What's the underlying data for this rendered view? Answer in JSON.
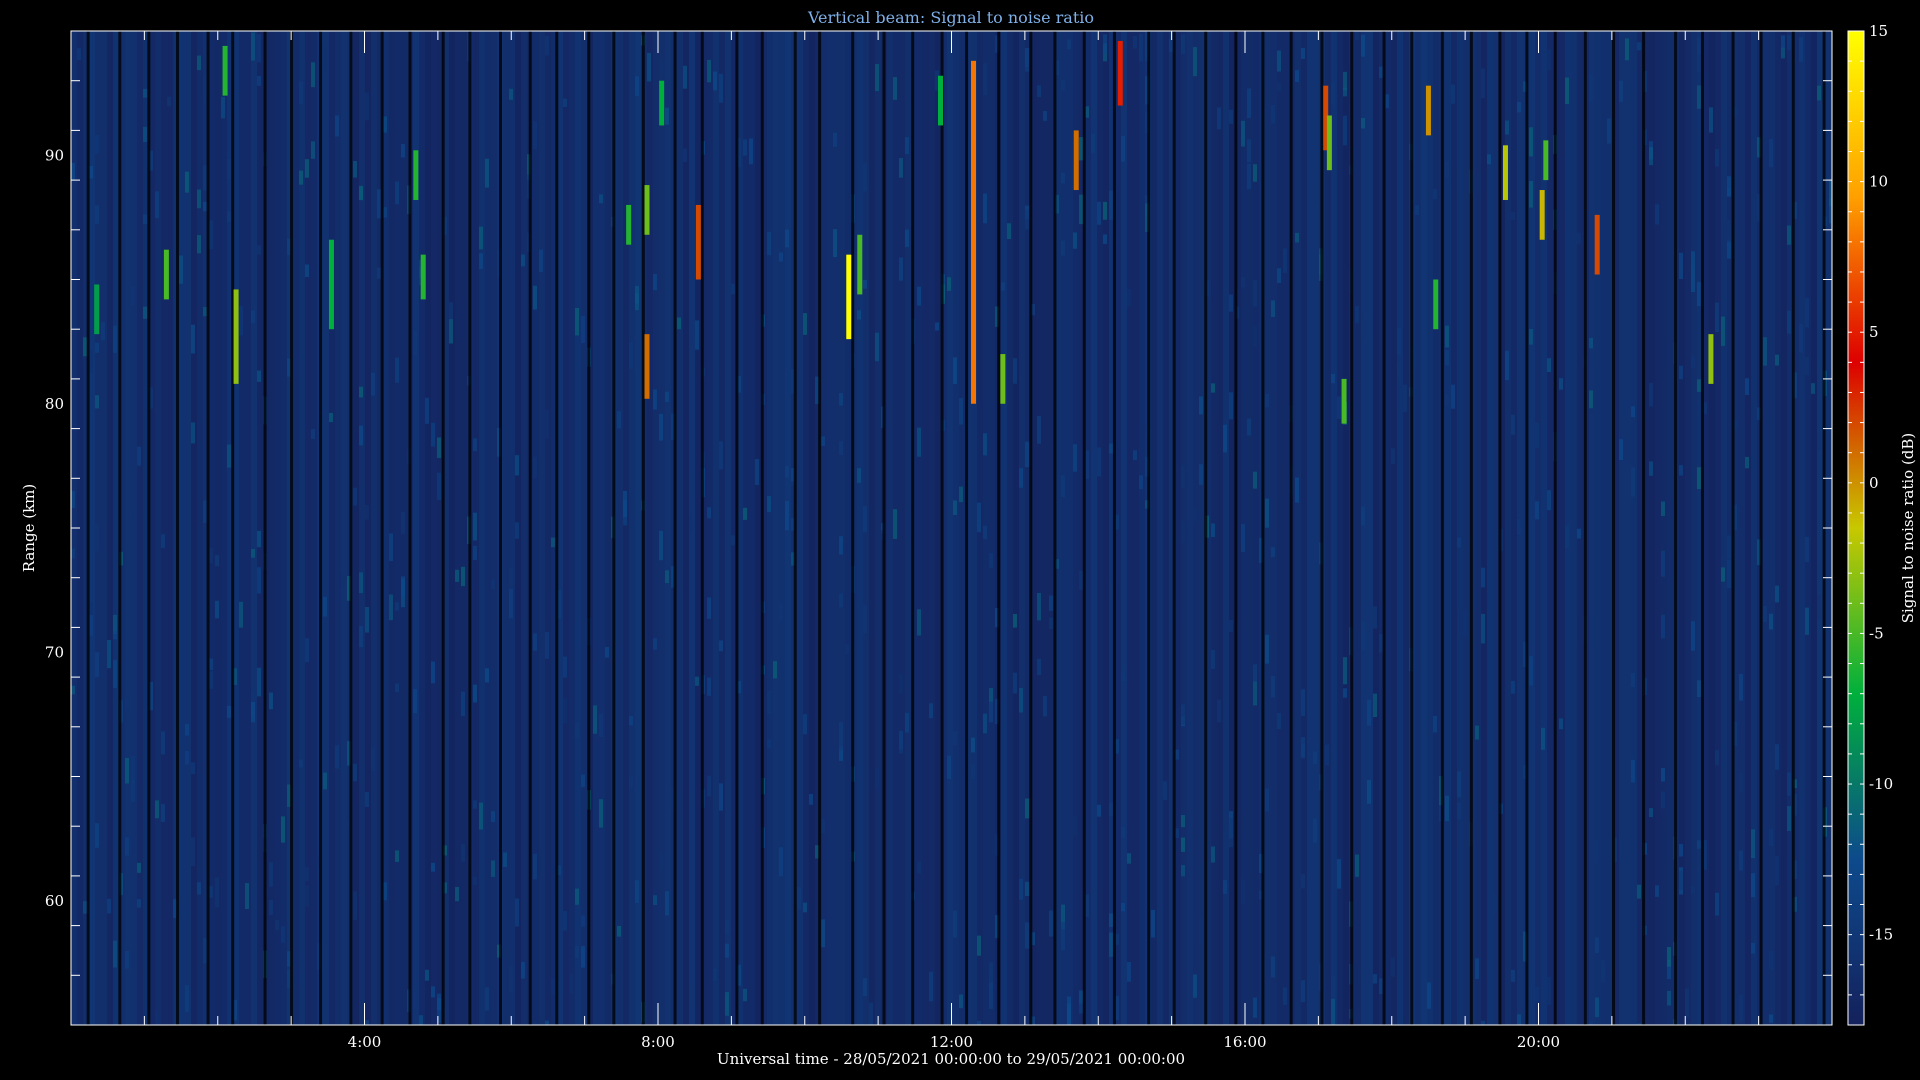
{
  "chart_data": {
    "type": "heatmap",
    "title": "Vertical beam: Signal to noise ratio",
    "xlabel": "Universal time - 28/05/2021 00:00:00 to 29/05/2021 00:00:00",
    "ylabel": "Range (km)",
    "colorbar_label": "Signal to noise ratio (dB)",
    "x_range_hours": [
      0,
      24
    ],
    "y_range_km": [
      55,
      95
    ],
    "color_range_db": [
      -18,
      15
    ],
    "x_ticks": [
      {
        "value": 4,
        "label": "4:00"
      },
      {
        "value": 8,
        "label": "8:00"
      },
      {
        "value": 12,
        "label": "12:00"
      },
      {
        "value": 16,
        "label": "16:00"
      },
      {
        "value": 20,
        "label": "20:00"
      }
    ],
    "y_ticks": [
      {
        "value": 60,
        "label": "60"
      },
      {
        "value": 70,
        "label": "70"
      },
      {
        "value": 80,
        "label": "80"
      },
      {
        "value": 90,
        "label": "90"
      }
    ],
    "colorbar_ticks": [
      {
        "value": 15,
        "label": "15"
      },
      {
        "value": 10,
        "label": "10"
      },
      {
        "value": 5,
        "label": "5"
      },
      {
        "value": 0,
        "label": "0"
      },
      {
        "value": -5,
        "label": "-5"
      },
      {
        "value": -10,
        "label": "-10"
      },
      {
        "value": -15,
        "label": "-15"
      }
    ],
    "colorscale": [
      "#14215c",
      "#0d4a8c",
      "#00b03c",
      "#c8c800",
      "#dd0000",
      "#ffa000",
      "#ffff00"
    ],
    "background_level_db": -16,
    "echoes": [
      {
        "time_h": 0.35,
        "range_start_km": 82.8,
        "range_end_km": 84.8,
        "snr_db": -8
      },
      {
        "time_h": 1.3,
        "range_start_km": 84.2,
        "range_end_km": 86.2,
        "snr_db": -5
      },
      {
        "time_h": 2.1,
        "range_start_km": 92.4,
        "range_end_km": 94.4,
        "snr_db": -6
      },
      {
        "time_h": 2.25,
        "range_start_km": 80.8,
        "range_end_km": 84.6,
        "snr_db": -3
      },
      {
        "time_h": 3.55,
        "range_start_km": 83.0,
        "range_end_km": 86.6,
        "snr_db": -7
      },
      {
        "time_h": 4.7,
        "range_start_km": 88.2,
        "range_end_km": 90.2,
        "snr_db": -6
      },
      {
        "time_h": 4.8,
        "range_start_km": 84.2,
        "range_end_km": 86.0,
        "snr_db": -6
      },
      {
        "time_h": 7.6,
        "range_start_km": 86.4,
        "range_end_km": 88.0,
        "snr_db": -6
      },
      {
        "time_h": 7.85,
        "range_start_km": 86.8,
        "range_end_km": 88.8,
        "snr_db": -4
      },
      {
        "time_h": 7.85,
        "range_start_km": 80.2,
        "range_end_km": 82.8,
        "snr_db": 1
      },
      {
        "time_h": 8.05,
        "range_start_km": 91.2,
        "range_end_km": 93.0,
        "snr_db": -7
      },
      {
        "time_h": 8.55,
        "range_start_km": 85.0,
        "range_end_km": 88.0,
        "snr_db": 2
      },
      {
        "time_h": 10.6,
        "range_start_km": 82.6,
        "range_end_km": 86.0,
        "snr_db": 15
      },
      {
        "time_h": 10.75,
        "range_start_km": 84.4,
        "range_end_km": 86.8,
        "snr_db": -5
      },
      {
        "time_h": 11.85,
        "range_start_km": 91.2,
        "range_end_km": 93.2,
        "snr_db": -7
      },
      {
        "time_h": 12.3,
        "range_start_km": 80.0,
        "range_end_km": 93.8,
        "snr_db": 8
      },
      {
        "time_h": 12.7,
        "range_start_km": 80.0,
        "range_end_km": 82.0,
        "snr_db": -4
      },
      {
        "time_h": 13.7,
        "range_start_km": 88.6,
        "range_end_km": 91.0,
        "snr_db": 1
      },
      {
        "time_h": 14.3,
        "range_start_km": 92.0,
        "range_end_km": 94.6,
        "snr_db": 5
      },
      {
        "time_h": 17.1,
        "range_start_km": 90.2,
        "range_end_km": 92.8,
        "snr_db": 2
      },
      {
        "time_h": 17.15,
        "range_start_km": 89.4,
        "range_end_km": 91.6,
        "snr_db": -4
      },
      {
        "time_h": 17.35,
        "range_start_km": 79.2,
        "range_end_km": 81.0,
        "snr_db": -5
      },
      {
        "time_h": 18.5,
        "range_start_km": 90.8,
        "range_end_km": 92.8,
        "snr_db": 0
      },
      {
        "time_h": 18.6,
        "range_start_km": 83.0,
        "range_end_km": 85.0,
        "snr_db": -6
      },
      {
        "time_h": 19.55,
        "range_start_km": 88.2,
        "range_end_km": 90.4,
        "snr_db": -2
      },
      {
        "time_h": 20.05,
        "range_start_km": 86.6,
        "range_end_km": 88.6,
        "snr_db": -1
      },
      {
        "time_h": 20.1,
        "range_start_km": 89.0,
        "range_end_km": 90.6,
        "snr_db": -5
      },
      {
        "time_h": 20.8,
        "range_start_km": 85.2,
        "range_end_km": 87.6,
        "snr_db": 2
      },
      {
        "time_h": 22.35,
        "range_start_km": 80.8,
        "range_end_km": 82.8,
        "snr_db": -3
      }
    ]
  }
}
